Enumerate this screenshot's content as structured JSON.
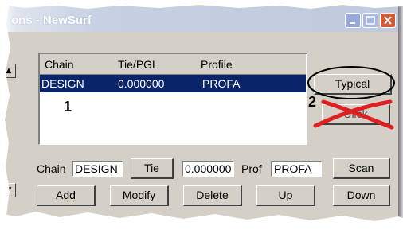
{
  "window": {
    "title": "ons - NewSurf",
    "title_buttons": {
      "minimize": "minimize-icon",
      "maximize": "maximize-icon",
      "close": "close-icon"
    }
  },
  "list": {
    "columns": [
      "Chain",
      "Tie/PGL",
      "Profile"
    ],
    "rows": [
      {
        "chain": "DESIGN",
        "tie": "0.000000",
        "profile": "PROFA",
        "selected": true
      }
    ]
  },
  "side_buttons": {
    "typical": "Typical",
    "second_obscured": "Ulick"
  },
  "annotations": {
    "number_1": "1",
    "number_2": "2"
  },
  "fields": {
    "chain_label": "Chain",
    "chain_value": "DESIGN",
    "tie_button": "Tie",
    "tie_value": "0.000000",
    "prof_label": "Prof",
    "prof_value": "PROFA",
    "scan_button": "Scan"
  },
  "buttons": {
    "add": "Add",
    "modify": "Modify",
    "delete": "Delete",
    "up": "Up",
    "down": "Down"
  },
  "colors": {
    "selection": "#0a246a",
    "dialog_face": "#d4d0c8",
    "red_mark": "#e02020"
  }
}
